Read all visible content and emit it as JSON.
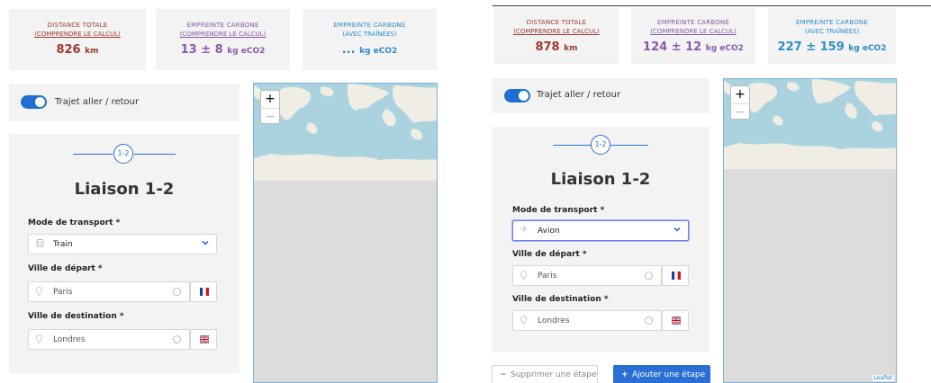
{
  "left": {
    "stats": [
      {
        "title": "DISTANCE TOTALE",
        "sub": "(COMPRENDRE LE CALCUL)",
        "value": "826",
        "unit": "km",
        "color": "#9c3a2e"
      },
      {
        "title": "EMPREINTE CARBONE",
        "sub": "(COMPRENDRE LE CALCUL)",
        "value": "13 ± 8",
        "unit": "kg eCO2",
        "color": "#8a5aa8"
      },
      {
        "title": "EMPREINTE CARBONE",
        "sub": "(AVEC TRAÎNÉES)",
        "value": "...",
        "unit": "kg eCO2",
        "color": "#2e8bc9"
      }
    ],
    "toggle": {
      "label": "Trajet aller / retour",
      "checked": true
    },
    "stage": {
      "badge": "1-2",
      "title": "Liaison 1-2"
    },
    "transport": {
      "label": "Mode de transport *",
      "value": "Train",
      "icon": "train-icon"
    },
    "departure": {
      "label": "Ville de départ *",
      "placeholder": "Paris",
      "flag": "flag-france-icon"
    },
    "destination": {
      "label": "Ville de destination *",
      "placeholder": "Londres",
      "flag": "flag-uk-icon"
    },
    "map": {
      "zoom_in": "+",
      "zoom_out": "−"
    }
  },
  "right": {
    "stats": [
      {
        "title": "DISTANCE TOTALE",
        "sub": "(COMPRENDRE LE CALCUL)",
        "value": "878",
        "unit": "km",
        "color": "#9c3a2e"
      },
      {
        "title": "EMPREINTE CARBONE",
        "sub": "(COMPRENDRE LE CALCUL)",
        "value": "124 ± 12",
        "unit": "kg eCO2",
        "color": "#8a5aa8"
      },
      {
        "title": "EMPREINTE CARBONE",
        "sub": "(AVEC TRAÎNÉES)",
        "value": "227 ± 159",
        "unit": "kg eCO2",
        "color": "#2e8bc9"
      }
    ],
    "toggle": {
      "label": "Trajet aller / retour",
      "checked": true
    },
    "stage": {
      "badge": "1-2",
      "title": "Liaison 1-2"
    },
    "transport": {
      "label": "Mode de transport *",
      "value": "Avion",
      "icon": "plane-icon"
    },
    "departure": {
      "label": "Ville de départ *",
      "placeholder": "Paris",
      "flag": "flag-france-icon"
    },
    "destination": {
      "label": "Ville de destination *",
      "placeholder": "Londres",
      "flag": "flag-uk-icon"
    },
    "buttons": {
      "remove": "Supprimer une étape",
      "add": "Ajouter une étape"
    },
    "map": {
      "zoom_in": "+",
      "zoom_out": "−",
      "attribution": "Leaflet"
    }
  },
  "colors": {
    "accent": "#2a6fd6",
    "card_bg": "#f3f3f3",
    "land": "#f0ede4",
    "sea": "#aad3df"
  }
}
